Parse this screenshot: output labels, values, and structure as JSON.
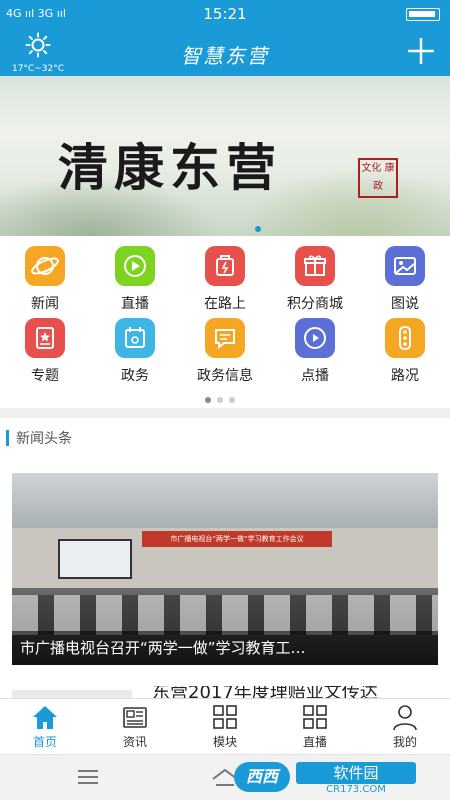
{
  "status_bar": {
    "signal": "4G ııl 3G ııl",
    "time": "15:21"
  },
  "header": {
    "title": "智慧东营",
    "temperature": "17°C~32°C"
  },
  "banner": {
    "title": "清康东营",
    "seal_text": "文化 康政"
  },
  "grid": {
    "items": [
      {
        "label": "新闻",
        "icon": "planet-icon",
        "color": "#f5a623"
      },
      {
        "label": "直播",
        "icon": "play-icon",
        "color": "#7ed321"
      },
      {
        "label": "在路上",
        "icon": "bag-icon",
        "color": "#e8504c"
      },
      {
        "label": "积分商城",
        "icon": "gift-icon",
        "color": "#e8504c"
      },
      {
        "label": "图说",
        "icon": "picture-icon",
        "color": "#5b6fd6"
      },
      {
        "label": "专题",
        "icon": "bookmark-icon",
        "color": "#e8504c"
      },
      {
        "label": "政务",
        "icon": "calendar-icon",
        "color": "#3fb5e6"
      },
      {
        "label": "政务信息",
        "icon": "message-icon",
        "color": "#f5a623"
      },
      {
        "label": "点播",
        "icon": "clock-play-icon",
        "color": "#5b6fd6"
      },
      {
        "label": "路况",
        "icon": "traffic-light-icon",
        "color": "#f5a623"
      }
    ]
  },
  "news": {
    "section_title": "新闻头条",
    "headline": "市广播电视台召开“两学一做”学习教育工…",
    "image_banner_text": "市广播电视台“两学一做”学习教育工作会议",
    "second_headline": "东营2017年度理赔业文传达"
  },
  "tabbar": {
    "tabs": [
      {
        "label": "首页",
        "active": true
      },
      {
        "label": "资讯",
        "active": false
      },
      {
        "label": "模块",
        "active": false
      },
      {
        "label": "直播",
        "active": false
      },
      {
        "label": "我的",
        "active": false
      }
    ]
  },
  "watermark": {
    "logo": "西西",
    "name": "软件园",
    "url": "CR173.COM"
  },
  "colors": {
    "accent": "#1a9ad6"
  }
}
